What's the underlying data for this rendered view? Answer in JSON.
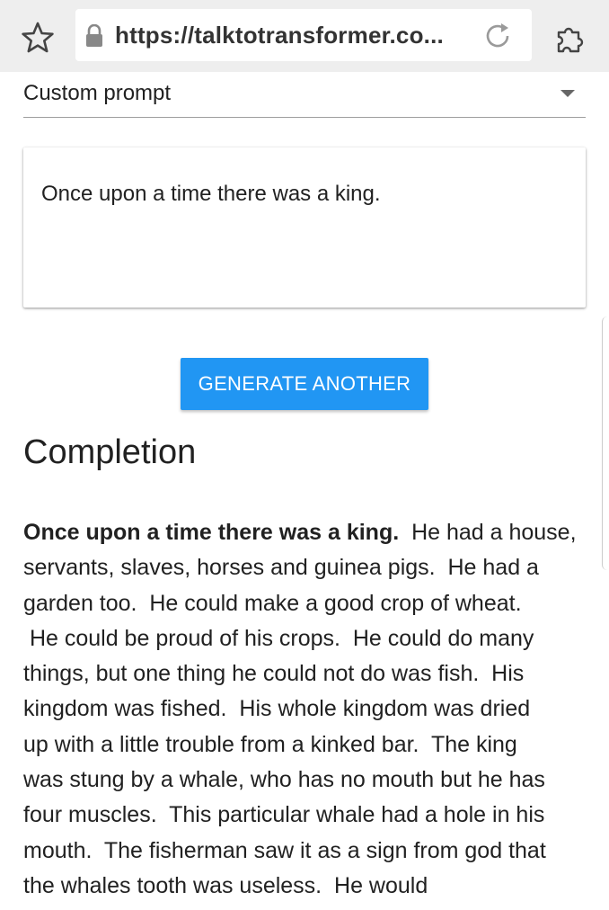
{
  "browser": {
    "url": "https://talktotransformer.co...",
    "icons": [
      "star-icon",
      "lock-icon",
      "reload-icon",
      "puzzle-icon"
    ]
  },
  "select": {
    "value": "Custom prompt"
  },
  "prompt": {
    "text": "Once upon a time there was a king."
  },
  "button": {
    "label": "GENERATE ANOTHER"
  },
  "completion": {
    "heading": "Completion",
    "prompt_bold": "Once upon a time there was a king.",
    "first_line_rest": "  He had a house,",
    "lines": [
      "servants, slaves, horses and guinea pigs.  He had a",
      "garden too.  He could make a good crop of wheat.",
      " He could be proud of his crops.  He could do many",
      "things, but one thing he could not do was fish.  His",
      "kingdom was fished.  His whole kingdom was dried",
      "up with a little trouble from a kinked bar.  The king",
      "was stung by a whale, who has no mouth but he has",
      "four muscles.  This particular whale had a hole in his",
      "mouth.  The fisherman saw it as a sign from god that",
      "the whales tooth was useless.  He would"
    ]
  },
  "colors": {
    "accent": "#2196f3",
    "toolbar": "#eeeeee",
    "text": "#212121"
  }
}
